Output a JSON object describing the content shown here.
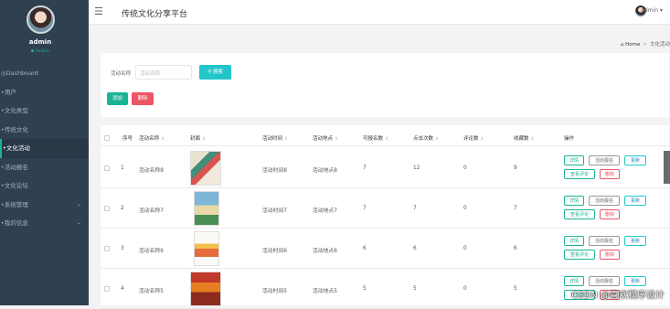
{
  "sidebar": {
    "user_name": "admin",
    "user_status": "Online",
    "items": [
      {
        "label": "Dashboard",
        "icon": "dashboard-icon"
      },
      {
        "label": "用户",
        "icon": "user-icon"
      },
      {
        "label": "文化类型",
        "icon": "tag-icon"
      },
      {
        "label": "传统文化",
        "icon": "tag-icon"
      },
      {
        "label": "文化活动",
        "icon": "tag-icon",
        "active": true
      },
      {
        "label": "活动报名",
        "icon": "tag-icon"
      },
      {
        "label": "文化论坛",
        "icon": "tag-icon"
      },
      {
        "label": "系统管理",
        "icon": "tag-icon",
        "expandable": true
      },
      {
        "label": "我的信息",
        "icon": "tag-icon",
        "expandable": true
      }
    ]
  },
  "header": {
    "site_title": "传统文化分享平台",
    "user": "admin"
  },
  "breadcrumb": {
    "home": "Home",
    "separator": ">",
    "current": "文化活动"
  },
  "search": {
    "label": "活动名称",
    "placeholder": "活动名称",
    "button": "搜索",
    "add": "添加",
    "delete": "删除"
  },
  "table": {
    "headers": [
      "序号",
      "活动名称",
      "封面",
      "活动时间",
      "活动地点",
      "可报名数",
      "点击次数",
      "评论数",
      "收藏数",
      "操作"
    ],
    "rows": [
      {
        "no": "1",
        "name": "活动名称8",
        "time": "活动时间8",
        "place": "活动地点8",
        "quota": "7",
        "clicks": "12",
        "comments": "0",
        "favs": "9"
      },
      {
        "no": "2",
        "name": "活动名称7",
        "time": "活动时间7",
        "place": "活动地点7",
        "quota": "7",
        "clicks": "7",
        "comments": "0",
        "favs": "7"
      },
      {
        "no": "3",
        "name": "活动名称6",
        "time": "活动时间6",
        "place": "活动地点6",
        "quota": "6",
        "clicks": "6",
        "comments": "0",
        "favs": "6"
      },
      {
        "no": "4",
        "name": "活动名称5",
        "time": "活动时间5",
        "place": "活动地点5",
        "quota": "5",
        "clicks": "5",
        "comments": "0",
        "favs": "5"
      }
    ],
    "actions": {
      "detail": "详情",
      "signup": "活动报名",
      "edit": "更新",
      "review": "查看评论",
      "delete": "删除"
    }
  },
  "watermark": "CSDN @喜欢程序设计",
  "colors": {
    "sidebar": "#2f4050",
    "primary": "#1ab394",
    "info": "#23c6c8",
    "danger": "#ed5565"
  }
}
